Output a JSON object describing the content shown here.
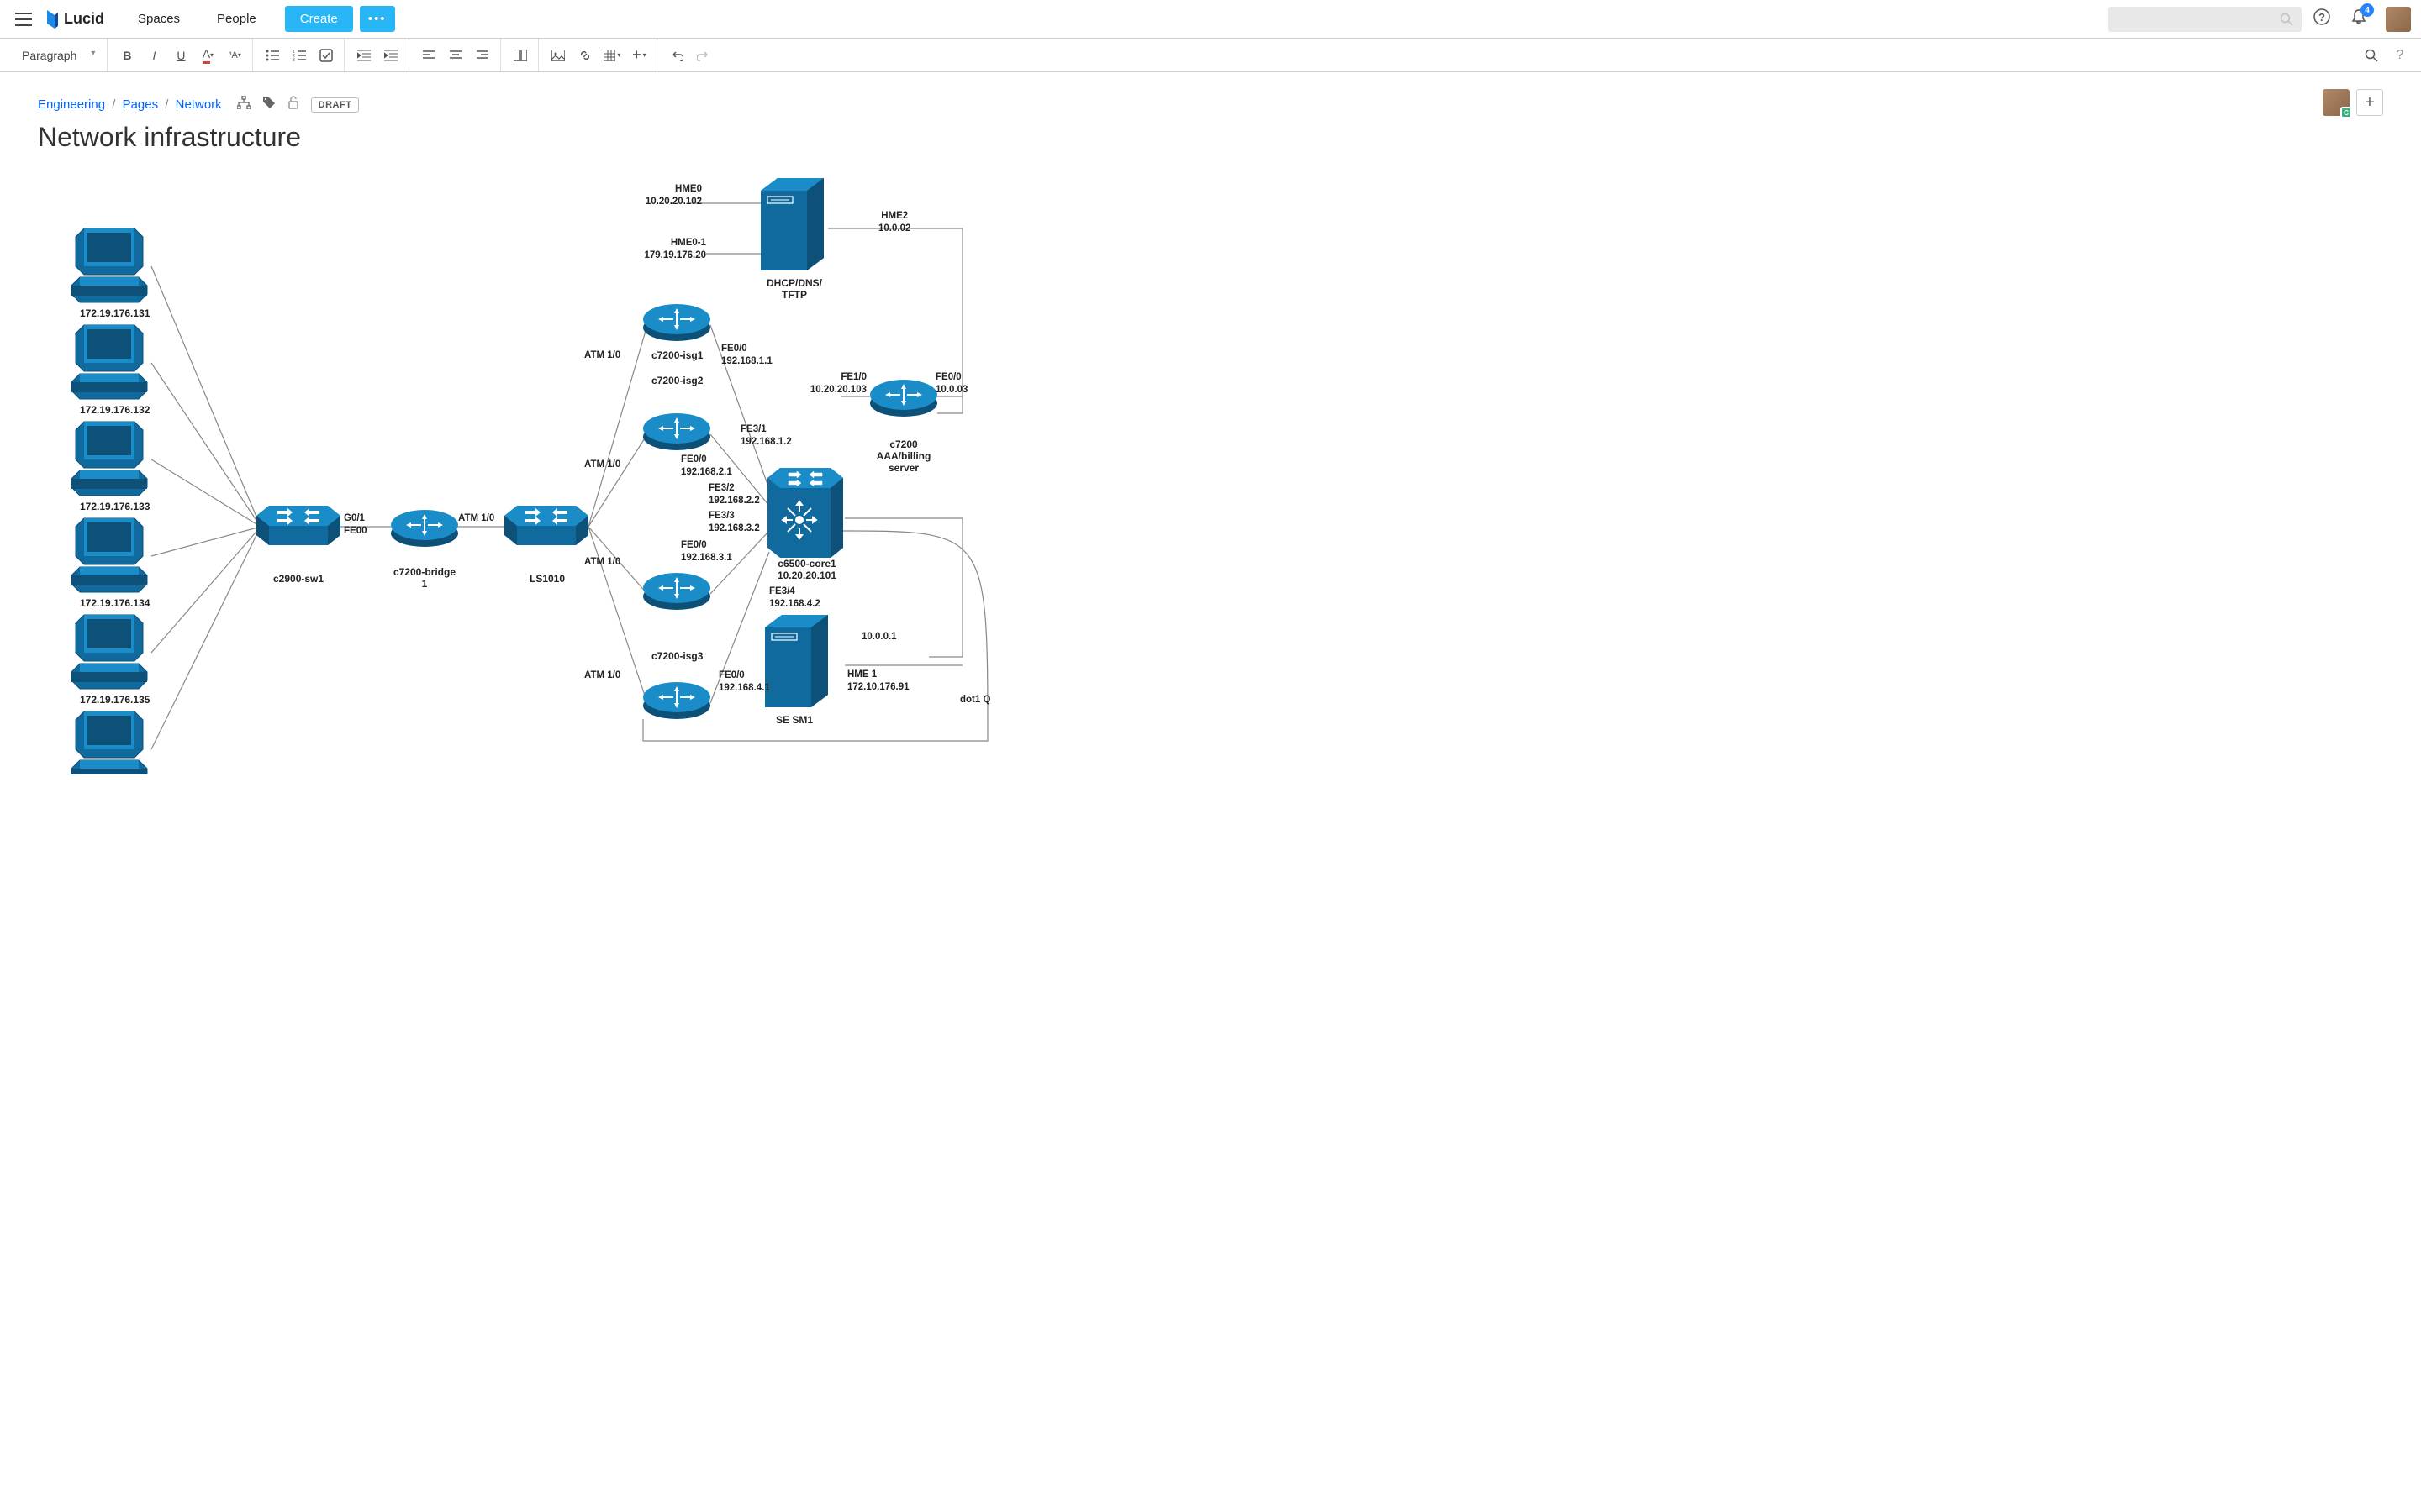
{
  "header": {
    "logo_text": "Lucid",
    "nav": {
      "spaces": "Spaces",
      "people": "People"
    },
    "create_label": "Create",
    "more_label": "•••",
    "notification_count": "4"
  },
  "toolbar": {
    "paragraph_label": "Paragraph"
  },
  "breadcrumbs": {
    "part1": "Engineering",
    "part2": "Pages",
    "part3": "Network",
    "draft_label": "DRAFT"
  },
  "page": {
    "title": "Network infrastructure"
  },
  "diagram": {
    "pcs": [
      {
        "ip": "172.19.176.131"
      },
      {
        "ip": "172.19.176.132"
      },
      {
        "ip": "172.19.176.133"
      },
      {
        "ip": "172.19.176.134"
      },
      {
        "ip": "172.19.176.135"
      }
    ],
    "nodes": {
      "c2900": "c2900-sw1",
      "bridge": "c7200-bridge\n1",
      "ls1010": "LS1010",
      "isg1": "c7200-isg1",
      "isg2": "c7200-isg2",
      "isg3": "c7200-isg3",
      "core": "c6500-core1\n10.20.20.101",
      "dhcp": "DHCP/DNS/\nTFTP",
      "aaa": "c7200\nAAA/billing\nserver",
      "sesm": "SE SM1"
    },
    "edge_labels": {
      "g01": "G0/1\nFE00",
      "atm10_bridge": "ATM 1/0",
      "atm_a": "ATM 1/0",
      "atm_b": "ATM 1/0",
      "atm_c": "ATM 1/0",
      "atm_d": "ATM 1/0",
      "hme0": "HME0\n10.20.20.102",
      "hme01": "HME0-1\n179.19.176.20",
      "hme2": "HME2\n10.0.02",
      "fe00_1": "FE0/0\n192.168.1.1",
      "fe31_12": "FE3/1\n192.168.1.2",
      "fe00_21": "FE0/0\n192.168.2.1",
      "fe32_22": "FE3/2\n192.168.2.2",
      "fe33_32": "FE3/3\n192.168.3.2",
      "fe00_31": "FE0/0\n192.168.3.1",
      "fe00_41": "FE0/0\n192.168.4.1",
      "fe34_42": "FE3/4\n192.168.4.2",
      "fe10": "FE1/0\n10.20.20.103",
      "fe00_03": "FE0/0\n10.0.03",
      "ip10001": "10.0.0.1",
      "hme1": "HME 1\n172.10.176.91",
      "dot1q": "dot1 Q"
    }
  }
}
